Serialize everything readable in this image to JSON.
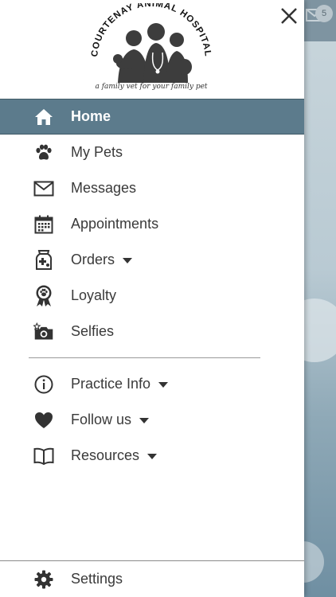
{
  "app": {
    "logo_text": "COURTENAY ANIMAL HOSPITAL",
    "tagline": "a family vet for your family pet"
  },
  "background": {
    "mail_badge_count": "5"
  },
  "colors": {
    "active_bg": "#5c7b8c",
    "text": "#3a3a3a",
    "icon": "#333333"
  },
  "menu": {
    "items": [
      {
        "label": "Home",
        "icon": "home-icon",
        "active": true
      },
      {
        "label": "My Pets",
        "icon": "paw-icon"
      },
      {
        "label": "Messages",
        "icon": "envelope-icon"
      },
      {
        "label": "Appointments",
        "icon": "calendar-icon"
      },
      {
        "label": "Orders",
        "icon": "pet-food-bag-icon",
        "dropdown": true
      },
      {
        "label": "Loyalty",
        "icon": "loyalty-ribbon-icon"
      },
      {
        "label": "Selfies",
        "icon": "camera-icon"
      }
    ],
    "secondary": [
      {
        "label": "Practice Info",
        "icon": "info-icon",
        "dropdown": true
      },
      {
        "label": "Follow us",
        "icon": "heart-icon",
        "dropdown": true
      },
      {
        "label": "Resources",
        "icon": "book-icon",
        "dropdown": true
      }
    ],
    "settings": {
      "label": "Settings",
      "icon": "gear-icon"
    }
  }
}
